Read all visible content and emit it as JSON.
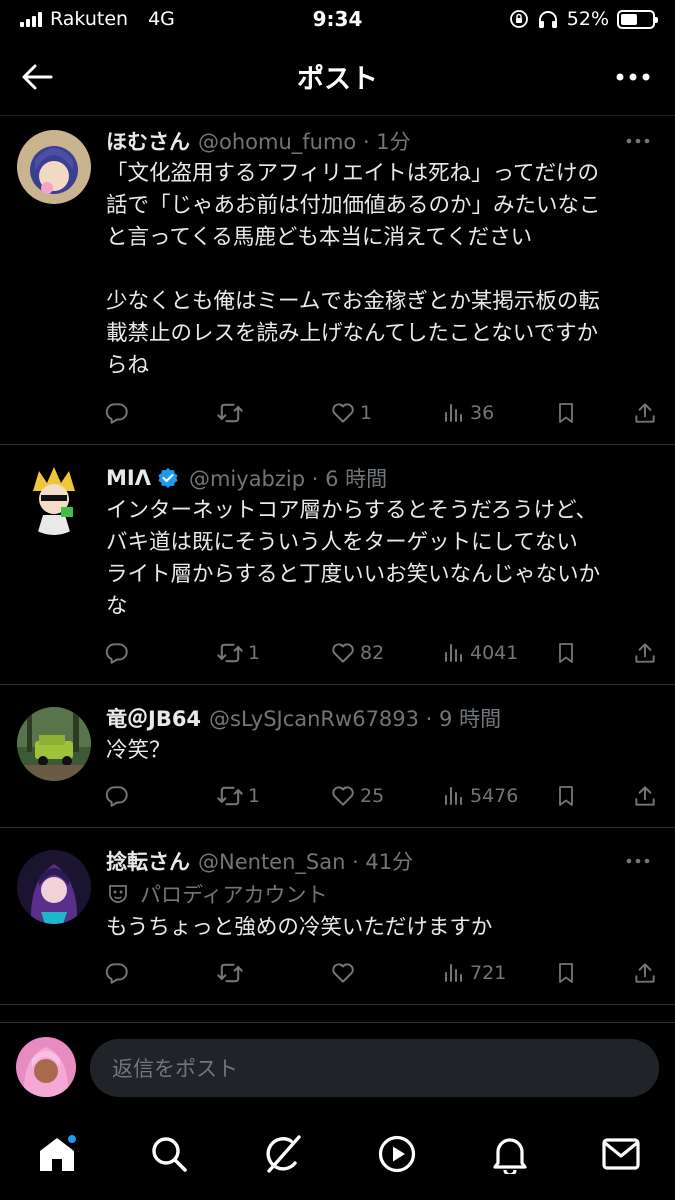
{
  "status_bar": {
    "carrier": "Rakuten",
    "network": "4G",
    "time": "9:34",
    "battery": "52%",
    "battery_level": 0.52
  },
  "header": {
    "title": "ポスト",
    "back_icon": "arrow-left-icon",
    "more_icon": "more-horizontal-icon"
  },
  "posts": [
    {
      "name": "ほむさん",
      "handle_time": "@ohomu_fumo · 1分",
      "body": "「文化盗用するアフィリエイトは死ね」ってだけの\n話で「じゃあお前は付加価値あるのか」みたいなこ\nと言ってくる馬鹿ども本当に消えてください\n\n少なくとも俺はミームでお金稼ぎとか某掲示板の転\n載禁止のレスを読み上げなんてしたことないですか\nらね",
      "replies": "",
      "reposts": "",
      "likes": "1",
      "views": "36"
    },
    {
      "name": "MIΛ",
      "verified": true,
      "handle_time": "@miyabzip · 6 時間",
      "body": "インターネットコア層からするとそうだろうけど、\nバキ道は既にそういう人をターゲットにしてない\nライト層からすると丁度いいお笑いなんじゃないか\nな",
      "replies": "",
      "reposts": "1",
      "likes": "82",
      "views": "4041"
    },
    {
      "name": "竜＠JB64",
      "handle_time": "@sLySJcanRw67893 · 9 時間",
      "body": "冷笑？",
      "replies": "",
      "reposts": "1",
      "likes": "25",
      "views": "5476"
    },
    {
      "name": "捻転さん",
      "handle_time": "@Nenten_San · 41分",
      "parody_label": "パロディアカウント",
      "body": "もうちょっと強めの冷笑いただけますか",
      "replies": "",
      "reposts": "",
      "likes": "",
      "views": "721"
    }
  ],
  "reply_bar": {
    "placeholder": "返信をポスト"
  },
  "bottom_nav": {
    "items": [
      "home-icon",
      "search-icon",
      "grok-icon",
      "video-icon",
      "notifications-icon",
      "messages-icon"
    ],
    "accent": "#1d9bf0"
  },
  "colors": {
    "background": "#000000",
    "text": "#e7e9ea",
    "secondary": "#71767b",
    "verified": "#1d9bf0"
  }
}
